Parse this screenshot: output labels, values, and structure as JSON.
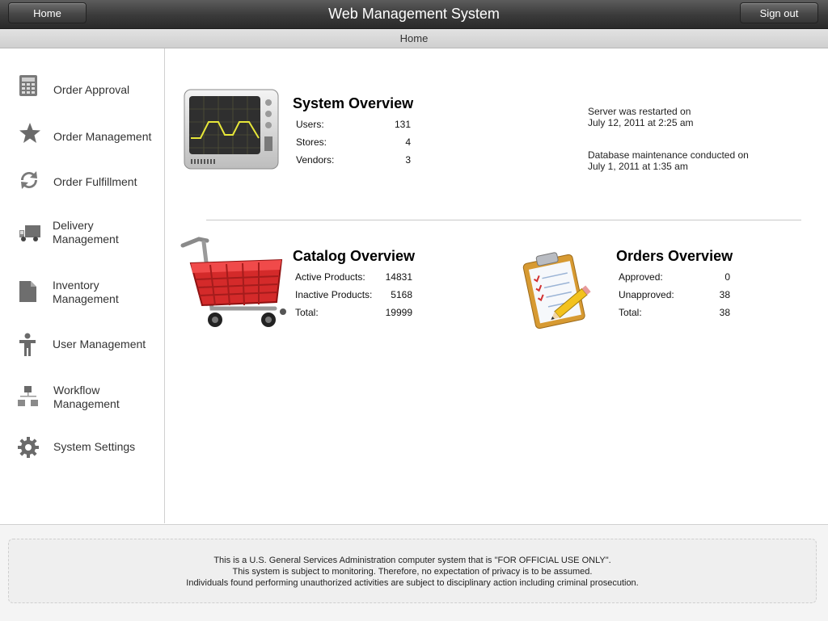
{
  "header": {
    "title": "Web Management System",
    "home_label": "Home",
    "signout_label": "Sign out",
    "breadcrumb": "Home"
  },
  "sidebar": {
    "items": [
      {
        "label": "Order Approval",
        "icon": "calculator-icon"
      },
      {
        "label": "Order Management",
        "icon": "star-icon"
      },
      {
        "label": "Order Fulfillment",
        "icon": "refresh-icon"
      },
      {
        "label_line1": "Delivery",
        "label_line2": "Management",
        "icon": "truck-icon"
      },
      {
        "label_line1": "Inventory",
        "label_line2": "Management",
        "icon": "document-icon"
      },
      {
        "label": "User Management",
        "icon": "person-icon"
      },
      {
        "label_line1": "Workflow",
        "label_line2": "Management",
        "icon": "workflow-icon"
      },
      {
        "label": "System Settings",
        "icon": "gear-icon"
      }
    ]
  },
  "system_overview": {
    "title": "System Overview",
    "rows": [
      {
        "label": "Users:",
        "value": "131"
      },
      {
        "label": "Stores:",
        "value": "4"
      },
      {
        "label": "Vendors:",
        "value": "3"
      }
    ],
    "notes": [
      {
        "line1": "Server was restarted on",
        "line2": "July 12, 2011 at 2:25 am"
      },
      {
        "line1": "Database maintenance conducted on",
        "line2": "July 1, 2011 at 1:35 am"
      }
    ]
  },
  "catalog_overview": {
    "title": "Catalog Overview",
    "rows": [
      {
        "label": "Active Products:",
        "value": "14831"
      },
      {
        "label": "Inactive Products:",
        "value": "5168"
      },
      {
        "label": "Total:",
        "value": "19999"
      }
    ]
  },
  "orders_overview": {
    "title": "Orders Overview",
    "rows": [
      {
        "label": "Approved:",
        "value": "0"
      },
      {
        "label": "Unapproved:",
        "value": "38"
      },
      {
        "label": "Total:",
        "value": "38"
      }
    ]
  },
  "footer": {
    "line1": "This is a U.S. General Services Administration computer system that is \"FOR OFFICIAL USE ONLY\".",
    "line2": "This system is subject to monitoring. Therefore, no expectation of privacy is to be assumed.",
    "line3": "Individuals found performing unauthorized activities are subject to disciplinary action including criminal prosecution."
  }
}
